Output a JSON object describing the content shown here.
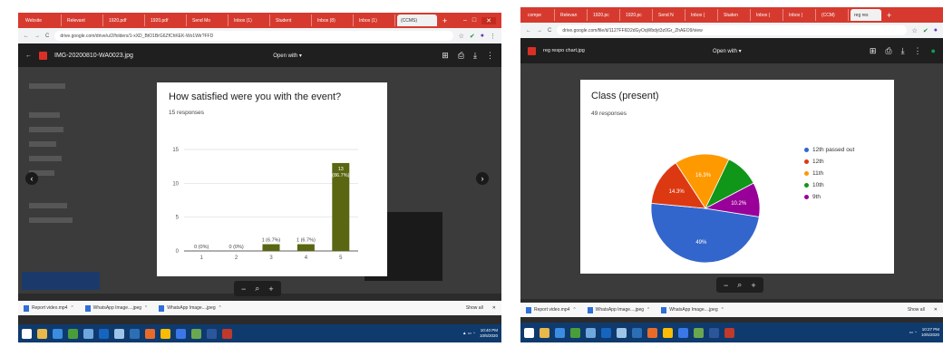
{
  "left": {
    "tabs": [
      "Website",
      "Relevant",
      "1920.pdf",
      "1920.pdf",
      "Send Mo",
      "Inbox (1)",
      "Student",
      "Inbox (8)",
      "Inbox (1)",
      "(CCMS)"
    ],
    "url": "drive.google.com/drive/u/2/folders/1-xXD_BtO1BrG6ZfChKEK-Wo1Wir?FFD",
    "file_name": "IMG-20200810-WA0023.jpg",
    "open_with": "Open with",
    "chart_card": {
      "title": "How satisfied were you with the event?",
      "responses": "15 responses"
    },
    "downloads": [
      "Report video.mp4",
      "WhatsApp Image....jpeg",
      "WhatsApp Image....jpeg"
    ],
    "show_all": "Show all",
    "clock": {
      "time": "10:40 PM",
      "date": "10/5/2020"
    }
  },
  "right": {
    "tabs": [
      "compe",
      "Relevan",
      "1920.pc",
      "1920.pc",
      "Send N",
      "Inbox (",
      "Studen",
      "Inbox (",
      "Inbox (",
      "(CCM)",
      "reg res"
    ],
    "url": "drive.google.com/file/d/1127FF6D2dGyOqWbdyt3z0Gr_ZhAEO9/view",
    "file_name": "reg respo chart.jpg",
    "open_with": "Open with",
    "chart_card": {
      "title": "Class (present)",
      "responses": "49 responses"
    },
    "downloads": [
      "Report video.mp4",
      "WhatsApp Image....jpeg",
      "WhatsApp Image....jpeg"
    ],
    "show_all": "Show all",
    "clock": {
      "time": "10:27 PM",
      "date": "10/5/2020"
    }
  },
  "chart_data": [
    {
      "type": "bar",
      "title": "How satisfied were you with the event?",
      "subtitle": "15 responses",
      "categories": [
        "1",
        "2",
        "3",
        "4",
        "5"
      ],
      "values": [
        0,
        0,
        1,
        1,
        13
      ],
      "data_labels": [
        "0 (0%)",
        "0 (0%)",
        "1 (6.7%)",
        "1 (6.7%)",
        "13 (86.7%)"
      ],
      "yticks": [
        "0",
        "5",
        "10",
        "15"
      ],
      "ylim": [
        0,
        15
      ],
      "grid": true,
      "color": "#5a6612"
    },
    {
      "type": "pie",
      "title": "Class (present)",
      "subtitle": "49 responses",
      "labels": [
        "12th passed out",
        "12th",
        "11th",
        "10th",
        "9th"
      ],
      "values": [
        49,
        14.3,
        16.3,
        10.2,
        10.2
      ],
      "data_labels": [
        "49%",
        "14.3%",
        "16.3%",
        "",
        "10.2%"
      ],
      "colors": [
        "#3366cc",
        "#dc3912",
        "#ff9900",
        "#109618",
        "#990099"
      ],
      "legend": "right"
    }
  ]
}
